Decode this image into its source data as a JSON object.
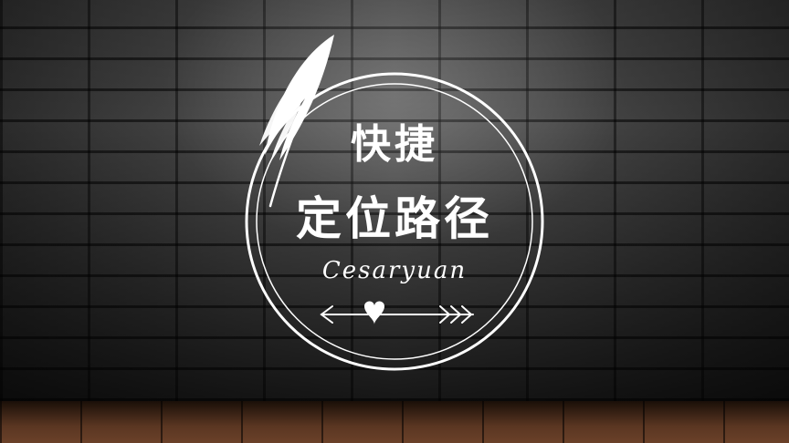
{
  "badge": {
    "title_line1": "快捷",
    "title_line2": "定位路径",
    "author": "Cesaryuan"
  },
  "icons": {
    "feather": "feather-icon",
    "arrow": "arrow-icon",
    "heart": "heart-icon"
  },
  "colors": {
    "foreground": "#ffffff",
    "wall": "#3a3a3a",
    "floor": "#5a3622"
  }
}
